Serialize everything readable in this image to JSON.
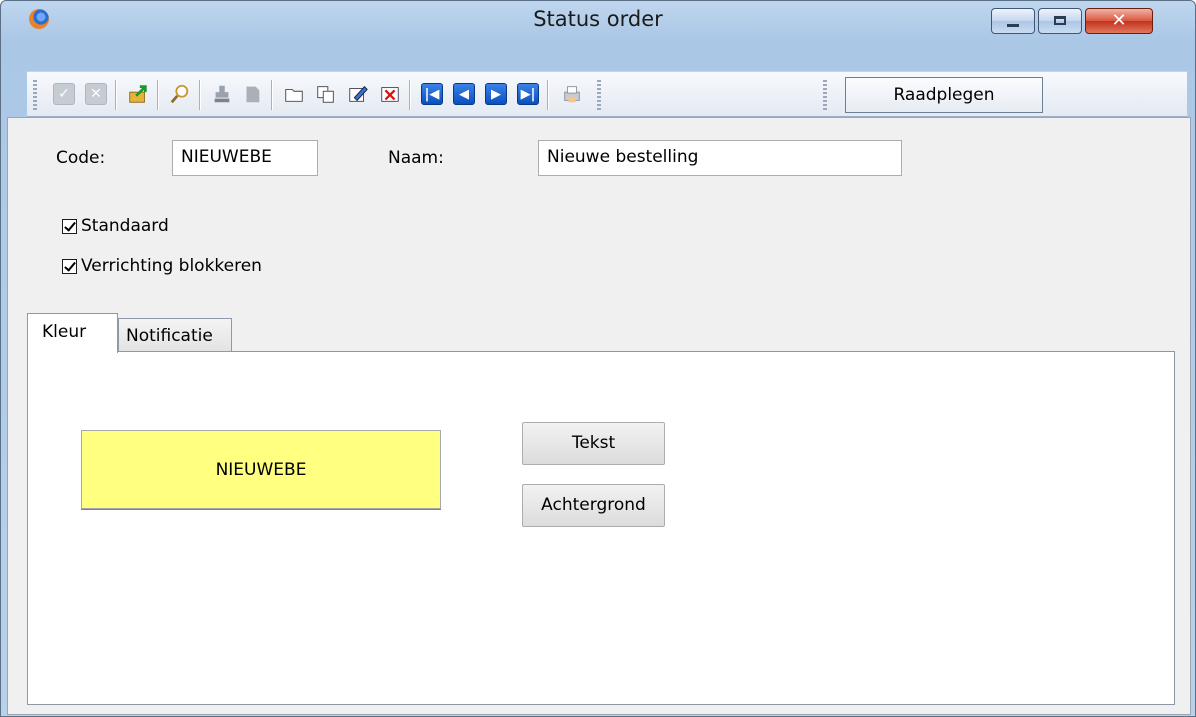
{
  "window": {
    "title": "Status order",
    "close_glyph": "✕"
  },
  "toolbar": {
    "mode_label": "Raadplegen",
    "icons": [
      "confirm-icon",
      "cancel-icon",
      "export-icon",
      "search-icon",
      "stamp-icon",
      "delete-record-icon",
      "open-folder-icon",
      "copy-icon",
      "edit-icon",
      "remove-icon",
      "first-record-icon",
      "previous-record-icon",
      "next-record-icon",
      "last-record-icon",
      "print-icon"
    ]
  },
  "form": {
    "code_label": "Code:",
    "code_value": "NIEUWEBE",
    "naam_label": "Naam:",
    "naam_value": "Nieuwe bestelling",
    "standaard_label": "Standaard",
    "standaard_checked": true,
    "blokkeren_label": "Verrichting blokkeren",
    "blokkeren_checked": true
  },
  "tabs": [
    {
      "label": "Kleur",
      "active": true
    },
    {
      "label": "Notificatie",
      "active": false
    }
  ],
  "kleur": {
    "preview_text": "NIEUWEBE",
    "preview_background": "#ffff80",
    "preview_text_color": "#000000",
    "text_button_label": "Tekst",
    "background_button_label": "Achtergrond"
  }
}
